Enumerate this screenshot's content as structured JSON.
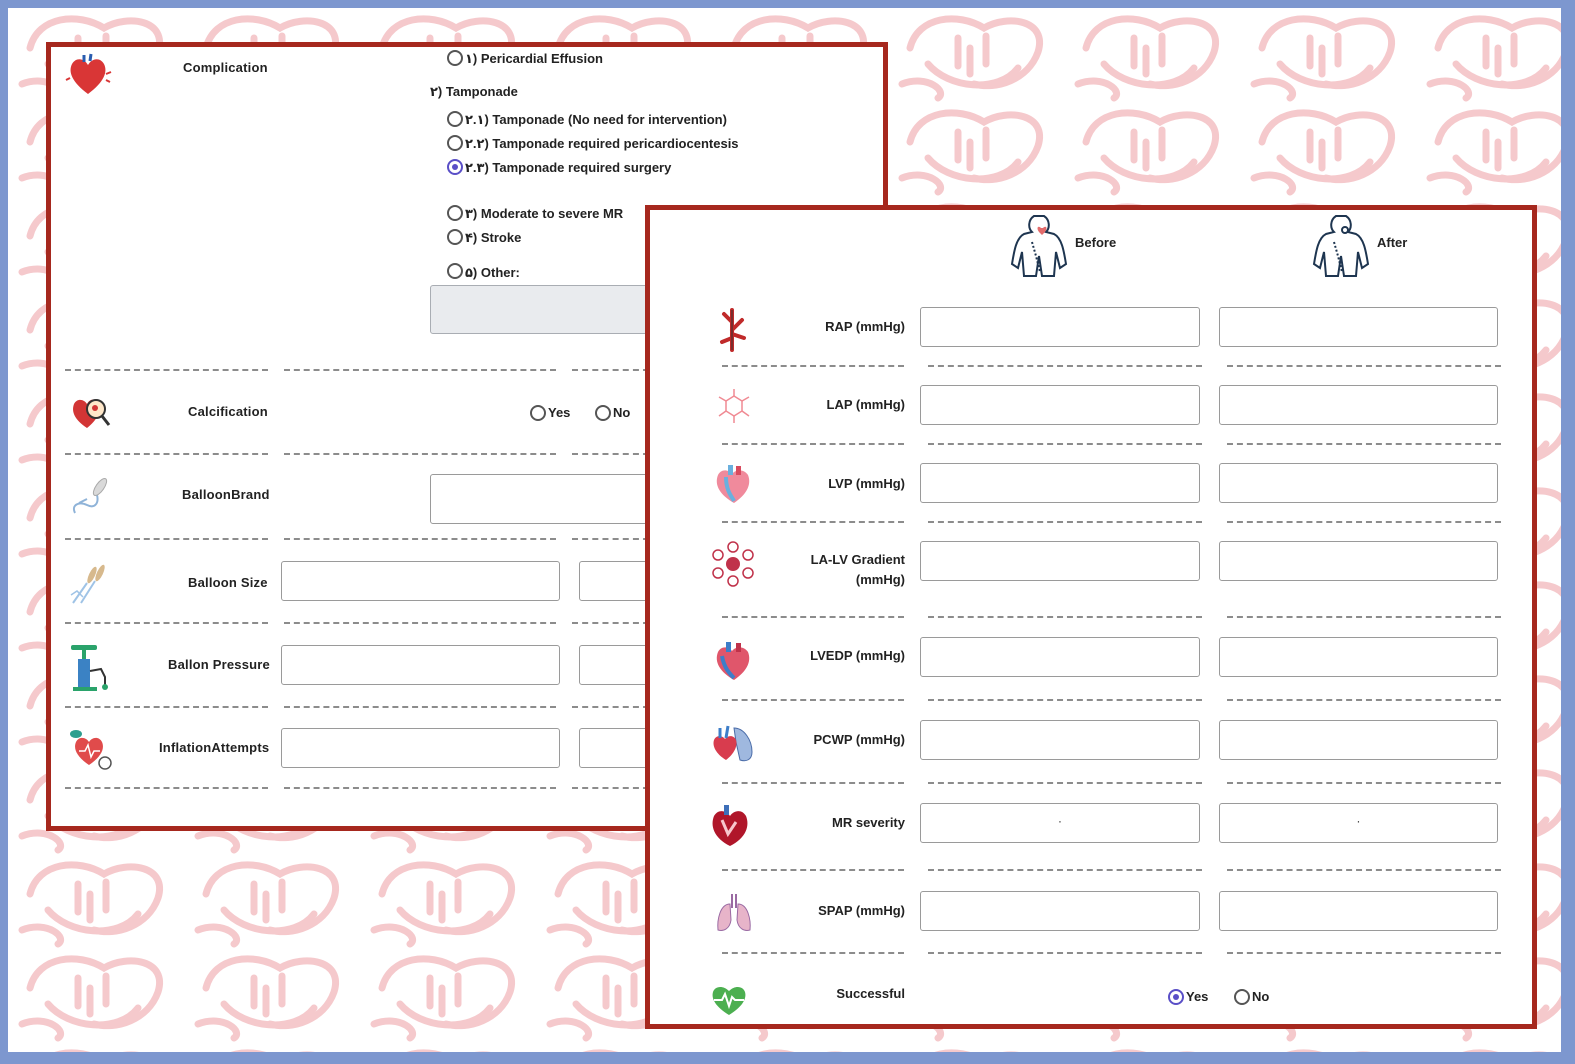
{
  "colors": {
    "frame_border": "#a6281e",
    "background": "#7d97cf",
    "radio_selected": "#5a4fc7",
    "watermark": "#f5c9cc"
  },
  "left_panel": {
    "complication": {
      "label": "Complication",
      "icon": "heart-icon",
      "options": [
        {
          "id": "pericardial_effusion",
          "label": "۱) Pericardial Effusion",
          "checked": false
        },
        {
          "id": "tamponade_header",
          "label": "۲) Tamponade"
        },
        {
          "id": "tamponade_no_intervention",
          "label": "۲.۱) Tamponade (No need for intervention)",
          "checked": false
        },
        {
          "id": "tamponade_pericardiocentesis",
          "label": "۲.۲) Tamponade required pericardiocentesis",
          "checked": false
        },
        {
          "id": "tamponade_surgery",
          "label": "۲.۳) Tamponade required surgery",
          "checked": true
        },
        {
          "id": "moderate_severe_mr",
          "label": "۳) Moderate to severe MR",
          "checked": false
        },
        {
          "id": "stroke",
          "label": "۴) Stroke",
          "checked": false
        },
        {
          "id": "other",
          "label": "۵) Other:",
          "checked": false
        }
      ],
      "other_value": ""
    },
    "calcification": {
      "label": "Calcification",
      "icon": "calcified-heart-magnifier-icon",
      "yes": "Yes",
      "no": "No",
      "selected": "none"
    },
    "balloon_brand": {
      "label": "BalloonBrand",
      "icon": "balloon-catheter-icon",
      "value": ""
    },
    "balloon_size": {
      "label": "Balloon Size",
      "icon": "balloon-size-icon",
      "value_1": "",
      "value_2": ""
    },
    "ballon_pressure": {
      "label": "Ballon Pressure",
      "icon": "pressure-pump-icon",
      "value_1": "",
      "value_2": ""
    },
    "inflation_attempts": {
      "label": "InflationAttempts",
      "icon": "blood-pressure-icon",
      "value_1": "",
      "value_2": ""
    }
  },
  "right_panel": {
    "before_label": "Before",
    "after_label": "After",
    "rows": [
      {
        "label": "RAP (mmHg)",
        "icon": "vein-icon",
        "before": "",
        "after": ""
      },
      {
        "label": "LAP (mmHg)",
        "icon": "molecule-icon",
        "before": "",
        "after": ""
      },
      {
        "label": "LVP (mmHg)",
        "icon": "heart-anatomy-icon",
        "before": "",
        "after": ""
      },
      {
        "label": "LA-LV Gradient (mmHg)",
        "icon": "heart-cycle-icon",
        "before": "",
        "after": ""
      },
      {
        "label": "LVEDP (mmHg)",
        "icon": "heart-anatomy-icon",
        "before": "",
        "after": ""
      },
      {
        "label": "PCWP (mmHg)",
        "icon": "heart-lung-icon",
        "before": "",
        "after": ""
      },
      {
        "label": "MR severity",
        "icon": "heart-cross-section-icon",
        "before": "۰",
        "after": "۰"
      },
      {
        "label": "SPAP (mmHg)",
        "icon": "lungs-icon",
        "before": "",
        "after": ""
      }
    ],
    "successful": {
      "label": "Successful",
      "icon": "heart-pulse-icon",
      "yes": "Yes",
      "no": "No",
      "selected": "yes"
    }
  }
}
